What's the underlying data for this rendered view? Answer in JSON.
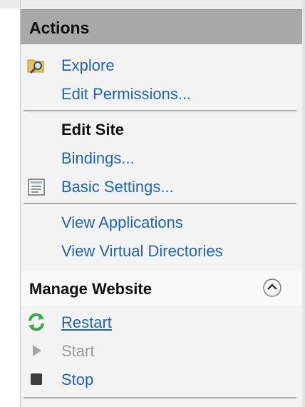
{
  "actions": {
    "title": "Actions",
    "explore": "Explore",
    "edit_permissions": "Edit Permissions...",
    "edit_site_heading": "Edit Site",
    "bindings": "Bindings...",
    "basic_settings": "Basic Settings...",
    "view_applications": "View Applications",
    "view_virtual_directories": "View Virtual Directories"
  },
  "manage_website": {
    "title": "Manage Website",
    "restart": "Restart",
    "start": "Start",
    "stop": "Stop"
  },
  "icons": {
    "explore": "folder-search-icon",
    "basic_settings": "settings-document-icon",
    "restart": "refresh-icon",
    "start": "play-icon",
    "stop": "stop-icon",
    "collapse": "chevron-up-icon"
  },
  "colors": {
    "link": "#1f63b5",
    "disabled": "#9a9a9a",
    "header_bg": "#a9a9a9",
    "panel_bg": "#f3f3f3"
  }
}
